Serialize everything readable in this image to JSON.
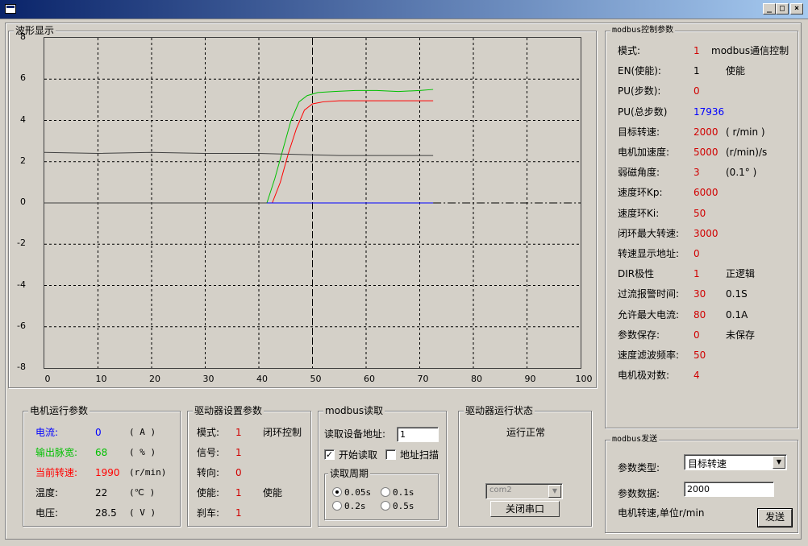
{
  "window": {
    "minimize": "_",
    "maximize": "□",
    "close": "×"
  },
  "waveform": {
    "title": "波形显示"
  },
  "chart_data": {
    "type": "line",
    "xlim": [
      0,
      100
    ],
    "ylim": [
      -8,
      8
    ],
    "xticks": [
      "0",
      "10",
      "20",
      "30",
      "40",
      "50",
      "60",
      "70",
      "80",
      "90",
      "100"
    ],
    "yticks": [
      "8",
      "6",
      "4",
      "2",
      "0",
      "-2",
      "-4",
      "-6",
      "-8"
    ],
    "grid": true,
    "series": [
      {
        "color": "#00c000",
        "x": [
          41.5,
          43,
          44.5,
          46,
          47.5,
          49,
          51,
          54,
          58,
          62,
          66,
          70,
          72.5
        ],
        "y": [
          0,
          1.2,
          2.6,
          4.0,
          4.9,
          5.2,
          5.35,
          5.4,
          5.45,
          5.45,
          5.4,
          5.45,
          5.5
        ]
      },
      {
        "color": "#ff0000",
        "x": [
          42.5,
          44,
          45.5,
          47,
          48.5,
          50,
          52,
          55,
          59,
          63,
          67,
          70,
          72.5
        ],
        "y": [
          0,
          1.0,
          2.4,
          3.6,
          4.5,
          4.8,
          4.9,
          4.95,
          4.95,
          4.95,
          4.95,
          4.95,
          4.95
        ]
      },
      {
        "color": "#404040",
        "x": [
          0,
          10,
          20,
          30,
          40,
          47,
          55,
          65,
          72.5
        ],
        "y": [
          2.45,
          2.4,
          2.45,
          2.4,
          2.4,
          2.35,
          2.3,
          2.3,
          2.3
        ]
      },
      {
        "color": "#404040",
        "x": [
          0,
          72.5
        ],
        "y": [
          0,
          0
        ]
      },
      {
        "color": "#0000ff",
        "x": [
          41.5,
          72.5
        ],
        "y": [
          0,
          0
        ]
      }
    ],
    "cursor_x": 50,
    "zero_dash_x": [
      72.5,
      100
    ]
  },
  "motor_run": {
    "title": "电机运行参数",
    "rows": [
      {
        "label": "电流:",
        "value": "0",
        "unit": "( A )",
        "color": "#0000ff"
      },
      {
        "label": "输出脉宽:",
        "value": "68",
        "unit": "( % )",
        "color": "#00c000"
      },
      {
        "label": "当前转速:",
        "value": "1990",
        "unit": "(r/min)",
        "color": "#ff0000"
      },
      {
        "label": "温度:",
        "value": "22",
        "unit": "(℃ )",
        "color": "#000000"
      },
      {
        "label": "电压:",
        "value": "28.5",
        "unit": "( V )",
        "color": "#000000"
      }
    ]
  },
  "driver_setup": {
    "title": "驱动器设置参数",
    "rows": [
      {
        "label": "模式:",
        "value": "1",
        "extra": "闭环控制"
      },
      {
        "label": "信号:",
        "value": "1",
        "extra": ""
      },
      {
        "label": "转向:",
        "value": "0",
        "extra": ""
      },
      {
        "label": "使能:",
        "value": "1",
        "extra": "使能"
      },
      {
        "label": "刹车:",
        "value": "1",
        "extra": ""
      }
    ]
  },
  "modbus_read": {
    "title": "modbus读取",
    "address_label": "读取设备地址:",
    "address_value": "1",
    "start_read_label": "开始读取",
    "address_scan_label": "地址扫描",
    "period_title": "读取周期",
    "periods": [
      "0.05s",
      "0.1s",
      "0.2s",
      "0.5s"
    ]
  },
  "driver_status": {
    "title": "驱动器运行状态",
    "status": "运行正常",
    "port": "com2",
    "close_port": "关闭串口"
  },
  "modbus_params": {
    "title": "modbus控制参数",
    "rows": [
      {
        "label": "模式:",
        "value": "1",
        "extra": "modbus通信控制",
        "vcolor": "#d00000"
      },
      {
        "label": "EN(使能):",
        "value": "1",
        "extra": "使能",
        "vcolor": "#000000"
      },
      {
        "label": "PU(步数):",
        "value": "0",
        "extra": "",
        "vcolor": "#d00000"
      },
      {
        "label": "PU(总步数)",
        "value": "17936",
        "extra": "",
        "vcolor": "#0000ff"
      },
      {
        "label": "目标转速:",
        "value": "2000",
        "extra": "( r/min )",
        "vcolor": "#d00000"
      },
      {
        "label": "电机加速度:",
        "value": "5000",
        "extra": "(r/min)/s",
        "vcolor": "#d00000"
      },
      {
        "label": "弱磁角度:",
        "value": "3",
        "extra": "(0.1° )",
        "vcolor": "#d00000"
      },
      {
        "label": "速度环Kp:",
        "value": "6000",
        "extra": "",
        "vcolor": "#d00000"
      },
      {
        "label": "速度环Ki:",
        "value": "50",
        "extra": "",
        "vcolor": "#d00000"
      },
      {
        "label": "闭环最大转速:",
        "value": "3000",
        "extra": "",
        "vcolor": "#d00000"
      },
      {
        "label": "转速显示地址:",
        "value": "0",
        "extra": "",
        "vcolor": "#d00000"
      },
      {
        "label": "DIR极性",
        "value": "1",
        "extra": "正逻辑",
        "vcolor": "#d00000"
      },
      {
        "label": "过流报警时间:",
        "value": "30",
        "extra": "0.1S",
        "vcolor": "#d00000"
      },
      {
        "label": "允许最大电流:",
        "value": "80",
        "extra": "0.1A",
        "vcolor": "#d00000"
      },
      {
        "label": "参数保存:",
        "value": "0",
        "extra": "未保存",
        "vcolor": "#d00000"
      },
      {
        "label": "速度滤波频率:",
        "value": "50",
        "extra": "",
        "vcolor": "#d00000"
      },
      {
        "label": "电机极对数:",
        "value": "4",
        "extra": "",
        "vcolor": "#d00000"
      }
    ]
  },
  "modbus_send": {
    "title": "modbus发送",
    "type_label": "参数类型:",
    "type_value": "目标转速",
    "data_label": "参数数据:",
    "data_value": "2000",
    "hint": "电机转速,单位r/min",
    "send": "发送"
  }
}
